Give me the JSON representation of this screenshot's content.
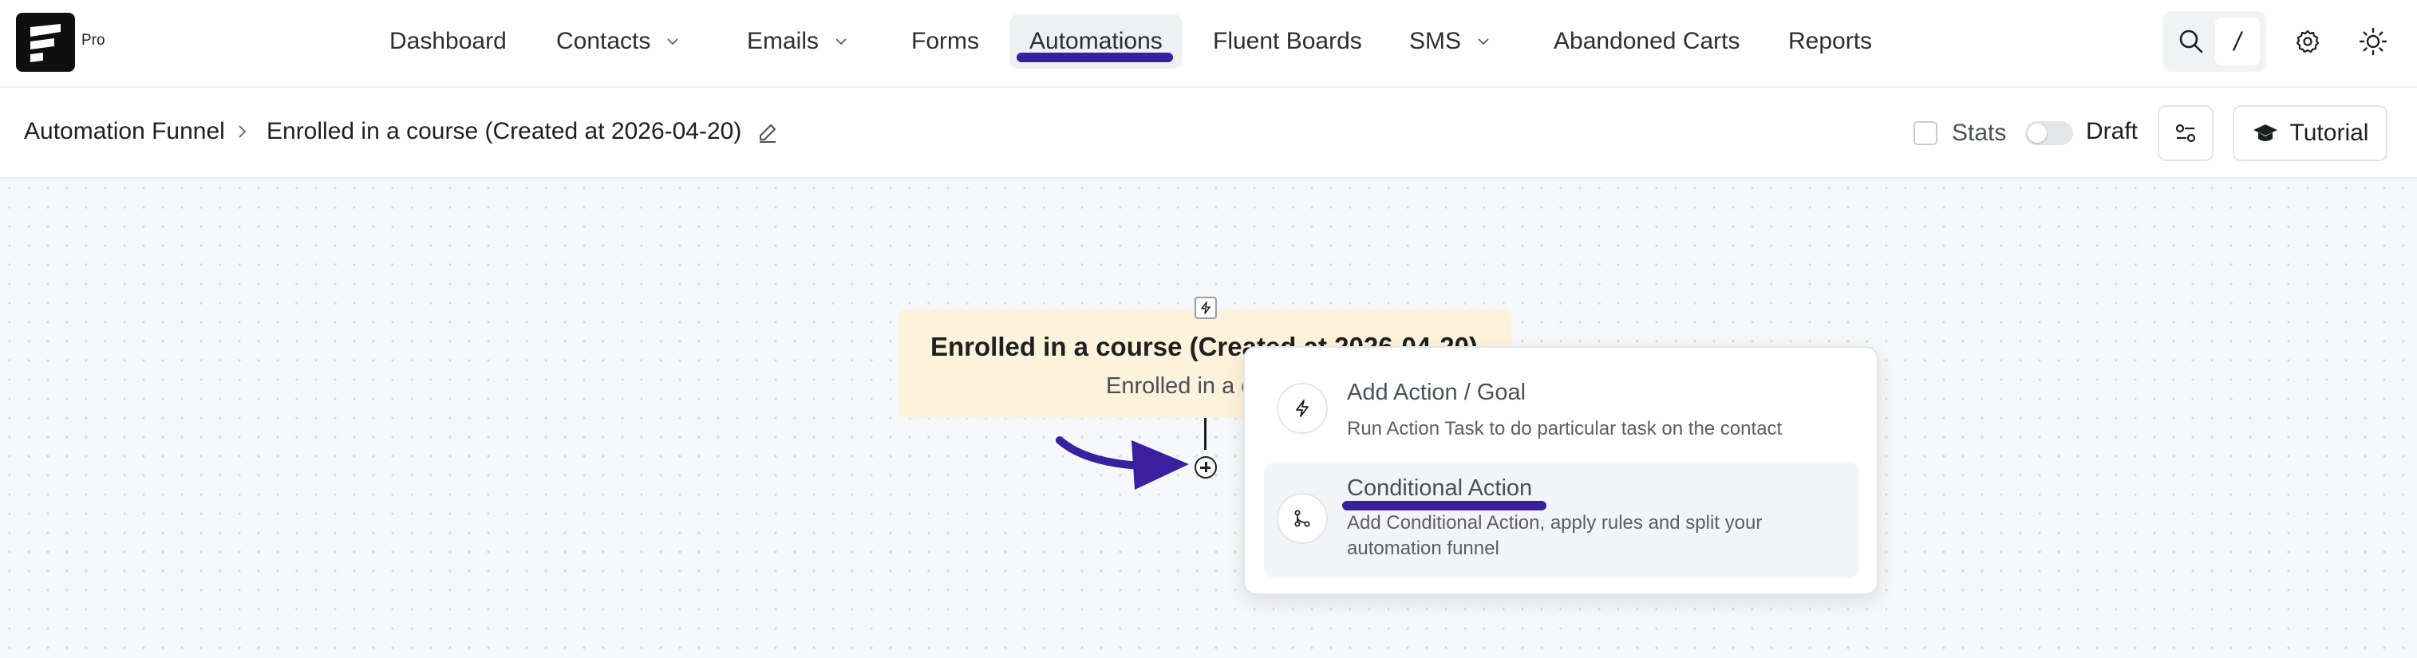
{
  "brand": {
    "tag": "Pro"
  },
  "nav": {
    "items": [
      {
        "label": "Dashboard"
      },
      {
        "label": "Contacts"
      },
      {
        "label": "Emails"
      },
      {
        "label": "Forms"
      },
      {
        "label": "Automations"
      },
      {
        "label": "Fluent Boards"
      },
      {
        "label": "SMS"
      },
      {
        "label": "Abandoned Carts"
      },
      {
        "label": "Reports"
      }
    ],
    "active": "Automations",
    "search_shortcut": "/"
  },
  "breadcrumb": {
    "root": "Automation Funnel",
    "current": "Enrolled in a course (Created at 2026-04-20)"
  },
  "header_controls": {
    "stats_label": "Stats",
    "stats_checked": false,
    "status_label": "Draft",
    "status_on": false,
    "tutorial_label": "Tutorial"
  },
  "trigger": {
    "title": "Enrolled in a course (Created at 2026-04-20)",
    "subtitle": "Enrolled in a course"
  },
  "popup": {
    "items": [
      {
        "title": "Add Action / Goal",
        "description": "Run Action Task to do particular task on the contact",
        "icon": "bolt-icon"
      },
      {
        "title": "Conditional Action",
        "description": "Add Conditional Action, apply rules and split your automation funnel",
        "icon": "branch-icon"
      }
    ]
  },
  "colors": {
    "accent": "#3a1f9e",
    "trigger_bg": "#fdf2da",
    "canvas_bg": "#f6f7fa"
  }
}
